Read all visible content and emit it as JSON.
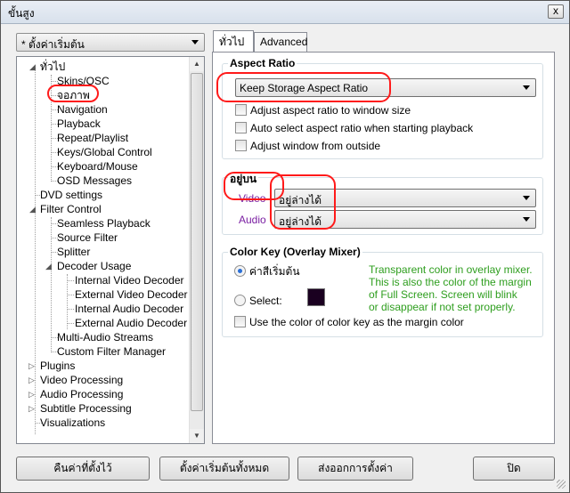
{
  "window": {
    "title": "ขั้นสูง",
    "close_glyph": "x"
  },
  "preset": {
    "value": "* ตั้งค่าเริ่มต้น"
  },
  "tree": {
    "items": [
      {
        "label": "ทั่วไป"
      },
      {
        "label": "Skins/OSC"
      },
      {
        "label": "จอภาพ"
      },
      {
        "label": "Navigation"
      },
      {
        "label": "Playback"
      },
      {
        "label": "Repeat/Playlist"
      },
      {
        "label": "Keys/Global Control"
      },
      {
        "label": "Keyboard/Mouse"
      },
      {
        "label": "OSD Messages"
      },
      {
        "label": "DVD settings"
      },
      {
        "label": "Filter Control"
      },
      {
        "label": "Seamless Playback"
      },
      {
        "label": "Source Filter"
      },
      {
        "label": "Splitter"
      },
      {
        "label": "Decoder Usage"
      },
      {
        "label": "Internal Video Decoder"
      },
      {
        "label": "External Video Decoder"
      },
      {
        "label": "Internal Audio Decoder"
      },
      {
        "label": "External Audio Decoder"
      },
      {
        "label": "Multi-Audio Streams"
      },
      {
        "label": "Custom Filter Manager"
      },
      {
        "label": "Plugins"
      },
      {
        "label": "Video Processing"
      },
      {
        "label": "Audio Processing"
      },
      {
        "label": "Subtitle Processing"
      },
      {
        "label": "Visualizations"
      }
    ]
  },
  "tabs": [
    {
      "label": "ทั่วไป"
    },
    {
      "label": "Advanced"
    }
  ],
  "aspect": {
    "title": "Aspect Ratio",
    "select_value": "Keep Storage Aspect Ratio",
    "opt1": "Adjust aspect ratio to window size",
    "opt2": "Auto select aspect ratio when starting playback",
    "opt3": "Adjust window from outside"
  },
  "ontop": {
    "title": "อยู่บน",
    "video_label": "Video",
    "video_value": "อยู่ล่างได้",
    "audio_label": "Audio",
    "audio_value": "อยู่ล่างได้"
  },
  "colorkey": {
    "title": "Color Key (Overlay Mixer)",
    "radio_default": "ค่าสีเริ่มต้น",
    "radio_select": "Select:",
    "swatch_color": "#1a0020",
    "note_line1": "Transparent color in overlay mixer.",
    "note_line2": "This is also the color of the margin",
    "note_line3": "of Full Screen. Screen will blink",
    "note_line4": "or disappear if not set properly.",
    "margin_check": "Use the color of color key as the margin color"
  },
  "buttons": {
    "reset": "คืนค่าที่ตั้งไว้",
    "reset_all": "ตั้งค่าเริ่มต้นทั้งหมด",
    "export": "ส่งออกการตั้งค่า",
    "close": "ปิด"
  }
}
